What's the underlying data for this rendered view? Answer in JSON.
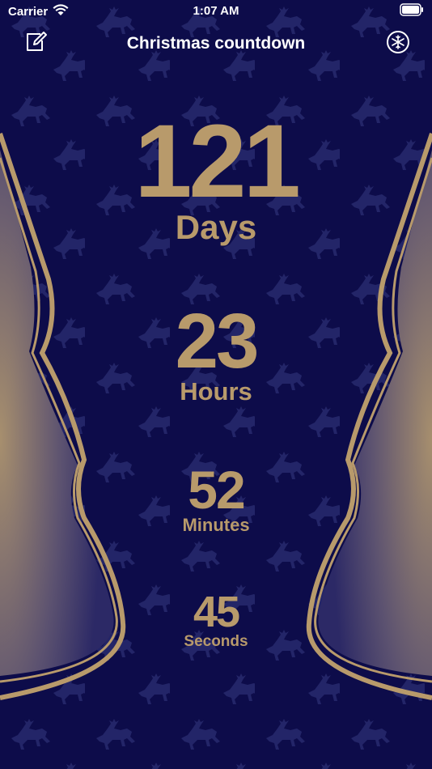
{
  "status_bar": {
    "carrier": "Carrier",
    "time": "1:07 AM"
  },
  "nav": {
    "title": "Christmas countdown",
    "left_icon": "edit-icon",
    "right_icon": "snowflake-icon"
  },
  "countdown": {
    "days": {
      "value": "121",
      "label": "Days"
    },
    "hours": {
      "value": "23",
      "label": "Hours"
    },
    "minutes": {
      "value": "52",
      "label": "Minutes"
    },
    "seconds": {
      "value": "45",
      "label": "Seconds"
    }
  },
  "colors": {
    "background": "#0d0c4a",
    "gold": "#b89a6b",
    "pattern": "#232568",
    "text_white": "#ffffff"
  },
  "decoration": {
    "pattern_icon": "reindeer-icon",
    "side_art": "christmas-tree-silhouette"
  }
}
